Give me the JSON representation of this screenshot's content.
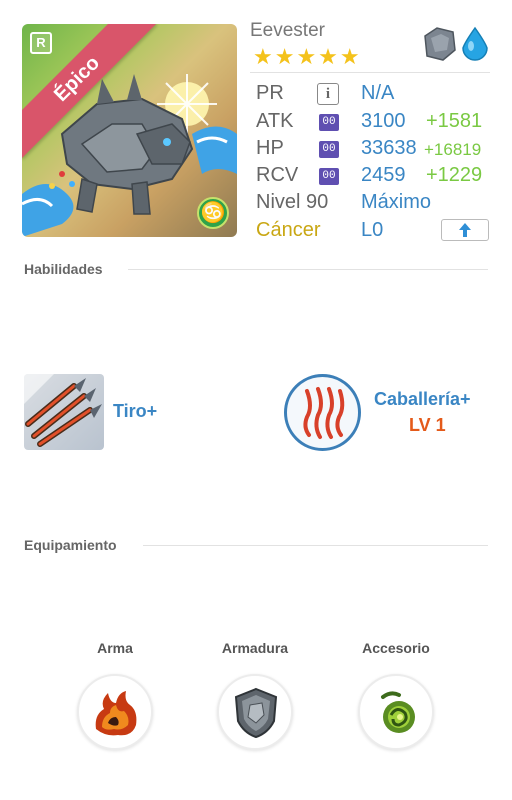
{
  "monster": {
    "name": "Eevester",
    "stars": "★★★★★",
    "rarity": "Épico",
    "badge": "R",
    "zodiac_symbol": "♋"
  },
  "stats": {
    "pr": {
      "label": "PR",
      "value": "N/A",
      "chip": "i"
    },
    "atk": {
      "label": "ATK",
      "chip": "00",
      "value": "3100",
      "bonus": "+1581"
    },
    "hp": {
      "label": "HP",
      "chip": "00",
      "value": "33638",
      "bonus": "+16819"
    },
    "rcv": {
      "label": "RCV",
      "chip": "00",
      "value": "2459",
      "bonus": "+1229"
    },
    "level": {
      "label": "Nivel 90",
      "value": "Máximo"
    },
    "sign": {
      "label": "Cáncer",
      "value": "L0"
    }
  },
  "colors": {
    "value_blue": "#3a86c4",
    "bonus_green": "#7ac943",
    "star_gold": "#f4c21b",
    "sign_gold": "#c9a714",
    "rarity_pink": "#d9556a",
    "level_orange": "#e45a1a"
  },
  "sections": {
    "abilities_title": "Habilidades",
    "equipment_title": "Equipamiento"
  },
  "skills": {
    "active": {
      "name": "Tiro+",
      "icon": "arrows-icon"
    },
    "leader": {
      "name": "Caballería+",
      "level": "LV 1",
      "icon": "claw-marks-icon"
    }
  },
  "equipment": [
    {
      "label": "Arma",
      "icon": "fire-claw-icon"
    },
    {
      "label": "Armadura",
      "icon": "stone-shield-icon"
    },
    {
      "label": "Accesorio",
      "icon": "green-swirl-icon"
    }
  ],
  "icons": {
    "element_1": "stone-element-icon",
    "element_2": "water-element-icon",
    "level_up": "up-arrow-icon"
  }
}
